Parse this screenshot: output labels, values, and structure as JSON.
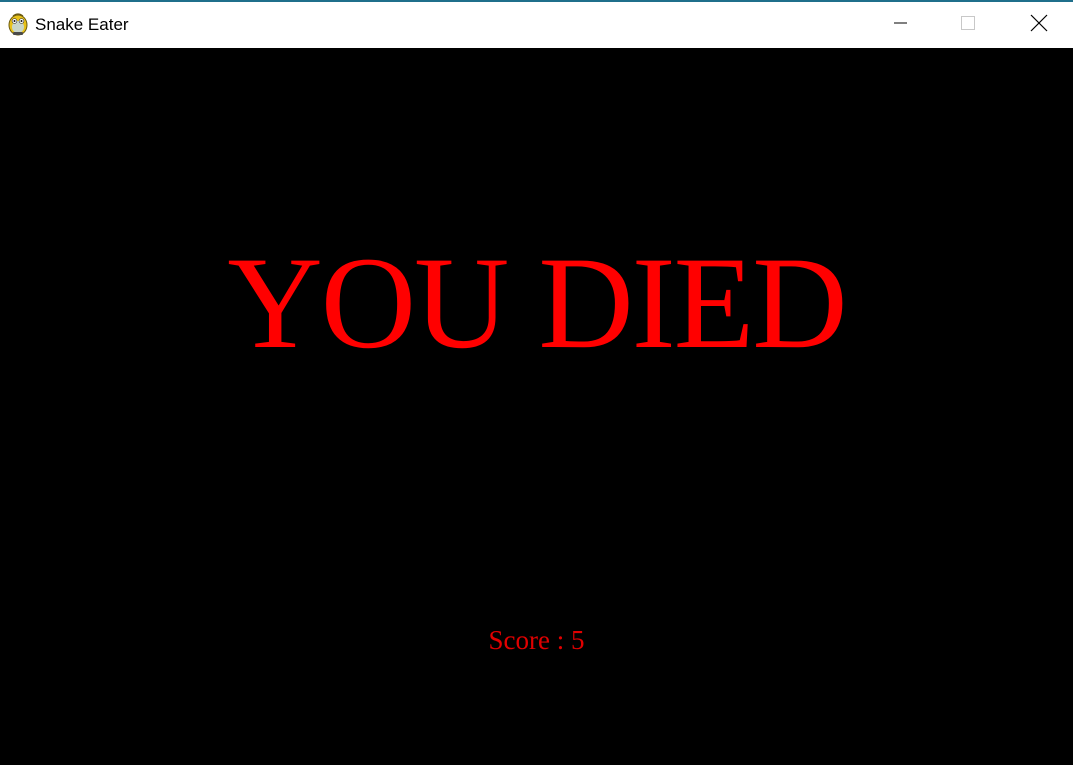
{
  "window": {
    "title": "Snake Eater",
    "icon": "pygame-snake-icon",
    "controls": {
      "minimize_icon": "minimize-icon",
      "maximize_icon": "maximize-icon",
      "close_icon": "close-icon"
    }
  },
  "game": {
    "background_color": "#000000",
    "text_color": "#ff0000",
    "game_over_text": "YOU DIED",
    "score_text": "Score : 5",
    "score": 5
  }
}
